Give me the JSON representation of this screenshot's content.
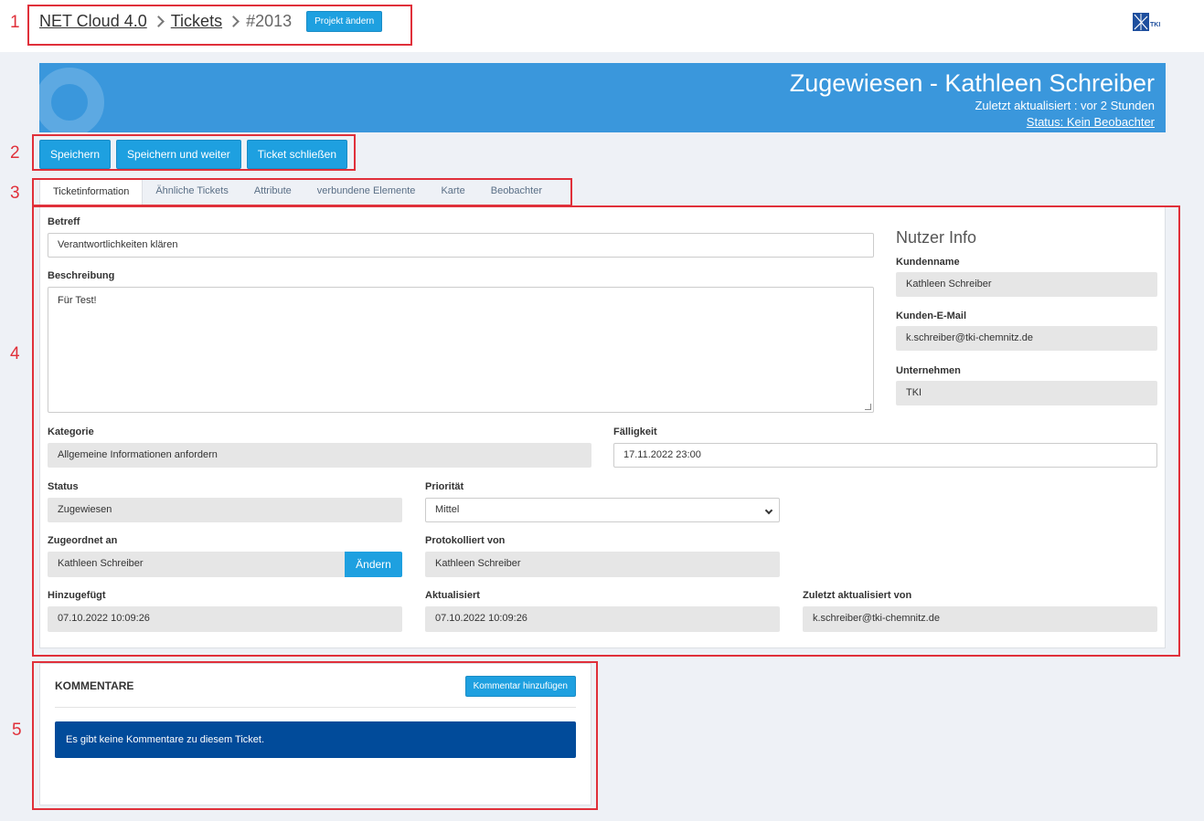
{
  "breadcrumb": {
    "items": [
      "NET Cloud 4.0",
      "Tickets"
    ],
    "current": "#2013",
    "change_project_label": "Projekt ändern"
  },
  "logo": {
    "text": "TKI"
  },
  "annotations": [
    "1",
    "2",
    "3",
    "4",
    "5"
  ],
  "banner": {
    "title": "Zugewiesen - Kathleen Schreiber",
    "last_updated": "Zuletzt aktualisiert : vor 2 Stunden",
    "status": "Status: Kein Beobachter"
  },
  "actions": {
    "save": "Speichern",
    "save_continue": "Speichern und weiter",
    "close_ticket": "Ticket schließen"
  },
  "tabs": [
    "Ticketinformation",
    "Ähnliche Tickets",
    "Attribute",
    "verbundene Elemente",
    "Karte",
    "Beobachter"
  ],
  "form": {
    "betreff_label": "Betreff",
    "betreff_value": "Verantwortlichkeiten klären",
    "beschreibung_label": "Beschreibung",
    "beschreibung_value": "Für Test!",
    "kategorie_label": "Kategorie",
    "kategorie_value": "Allgemeine Informationen anfordern",
    "faelligkeit_label": "Fälligkeit",
    "faelligkeit_value": "17.11.2022 23:00",
    "status_label": "Status",
    "status_value": "Zugewiesen",
    "prioritaet_label": "Priorität",
    "prioritaet_value": "Mittel",
    "zugeordnet_label": "Zugeordnet an",
    "zugeordnet_value": "Kathleen Schreiber",
    "aendern_label": "Ändern",
    "protokolliert_label": "Protokolliert von",
    "protokolliert_value": "Kathleen Schreiber",
    "hinzugefuegt_label": "Hinzugefügt",
    "hinzugefuegt_value": "07.10.2022 10:09:26",
    "aktualisiert_label": "Aktualisiert",
    "aktualisiert_value": "07.10.2022 10:09:26",
    "zuletzt_label": "Zuletzt aktualisiert von",
    "zuletzt_value": "k.schreiber@tki-chemnitz.de"
  },
  "nutzer": {
    "heading": "Nutzer Info",
    "kundenname_label": "Kundenname",
    "kundenname_value": "Kathleen Schreiber",
    "email_label": "Kunden-E-Mail",
    "email_value": "k.schreiber@tki-chemnitz.de",
    "unternehmen_label": "Unternehmen",
    "unternehmen_value": "TKI"
  },
  "comments": {
    "title": "KOMMENTARE",
    "add_label": "Kommentar hinzufügen",
    "empty_message": "Es gibt keine Kommentare zu diesem Ticket."
  },
  "colors": {
    "accent": "#1ea0e0",
    "banner": "#3a97dc",
    "alert": "#014b9a",
    "annotation": "#e0303a"
  }
}
